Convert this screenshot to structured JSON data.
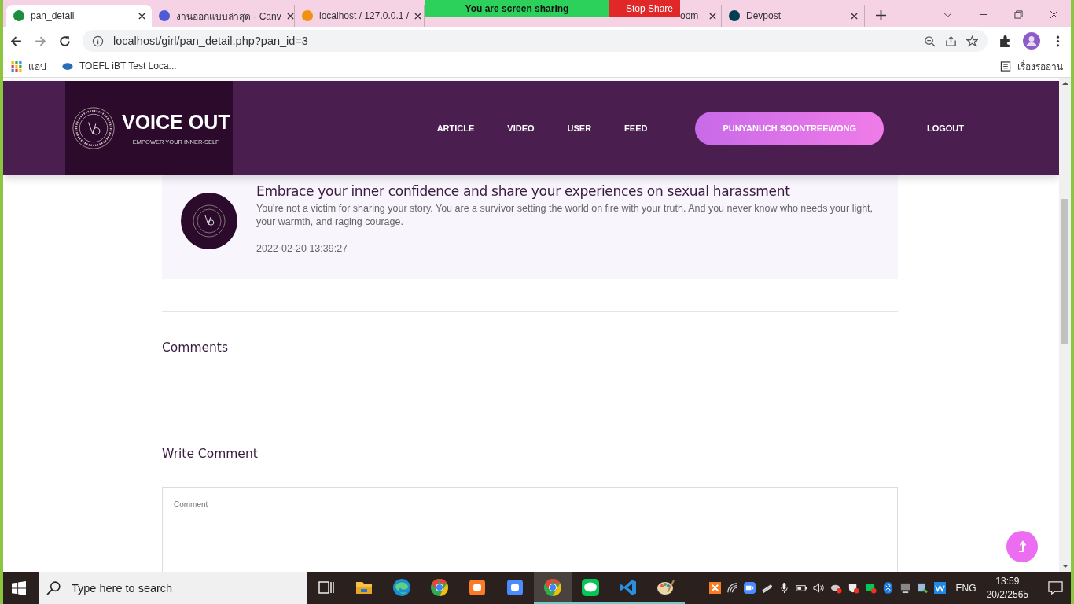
{
  "browser": {
    "tabs": [
      {
        "title": "pan_detail",
        "selected": true
      },
      {
        "title": "งานออกแบบล่าสุด - Canv",
        "selected": false
      },
      {
        "title": "localhost / 127.0.0.1 /",
        "selected": false
      },
      {
        "title": "oom",
        "selected": false
      },
      {
        "title": "Devpost",
        "selected": false
      }
    ],
    "share_banner": {
      "message": "You are screen sharing",
      "stop_button": "Stop Share"
    },
    "address": "localhost/girl/pan_detail.php?pan_id=3",
    "bookmarks": [
      {
        "label": "แอป"
      },
      {
        "label": "TOEFL iBT Test Loca..."
      }
    ],
    "reading_list": "เรื่องรออ่าน"
  },
  "header": {
    "brand": "VOICE OUT",
    "tagline": "EMPOWER YOUR INNER-SELF",
    "nav": [
      "ARTICLE",
      "VIDEO",
      "USER",
      "FEED"
    ],
    "user_button": "PUNYANUCH SOONTREEWONG",
    "logout": "LOGOUT"
  },
  "post": {
    "title": "Embrace your inner confidence and share your experiences on sexual harassment",
    "body": "You're not a victim for sharing your story. You are a survivor setting the world on fire with your truth. And you never know who needs your light, your warmth, and raging courage.",
    "date": "2022-02-20 13:39:27"
  },
  "comments": {
    "heading": "Comments"
  },
  "write_comment": {
    "heading": "Write Comment",
    "placeholder": "Comment"
  },
  "taskbar": {
    "search_placeholder": "Type here to search",
    "apps": [
      {
        "kind": "taskview",
        "open": false
      },
      {
        "kind": "folder",
        "open": false
      },
      {
        "kind": "edge",
        "open": false
      },
      {
        "kind": "chrome",
        "open": false
      },
      {
        "kind": "xampp",
        "open": false
      },
      {
        "kind": "zoom",
        "open": false
      },
      {
        "kind": "chrome",
        "open": true
      },
      {
        "kind": "line",
        "open": true
      },
      {
        "kind": "vscode",
        "open": true
      },
      {
        "kind": "paint",
        "open": true
      }
    ],
    "language": "ENG",
    "time": "13:59",
    "date": "20/2/2565"
  }
}
